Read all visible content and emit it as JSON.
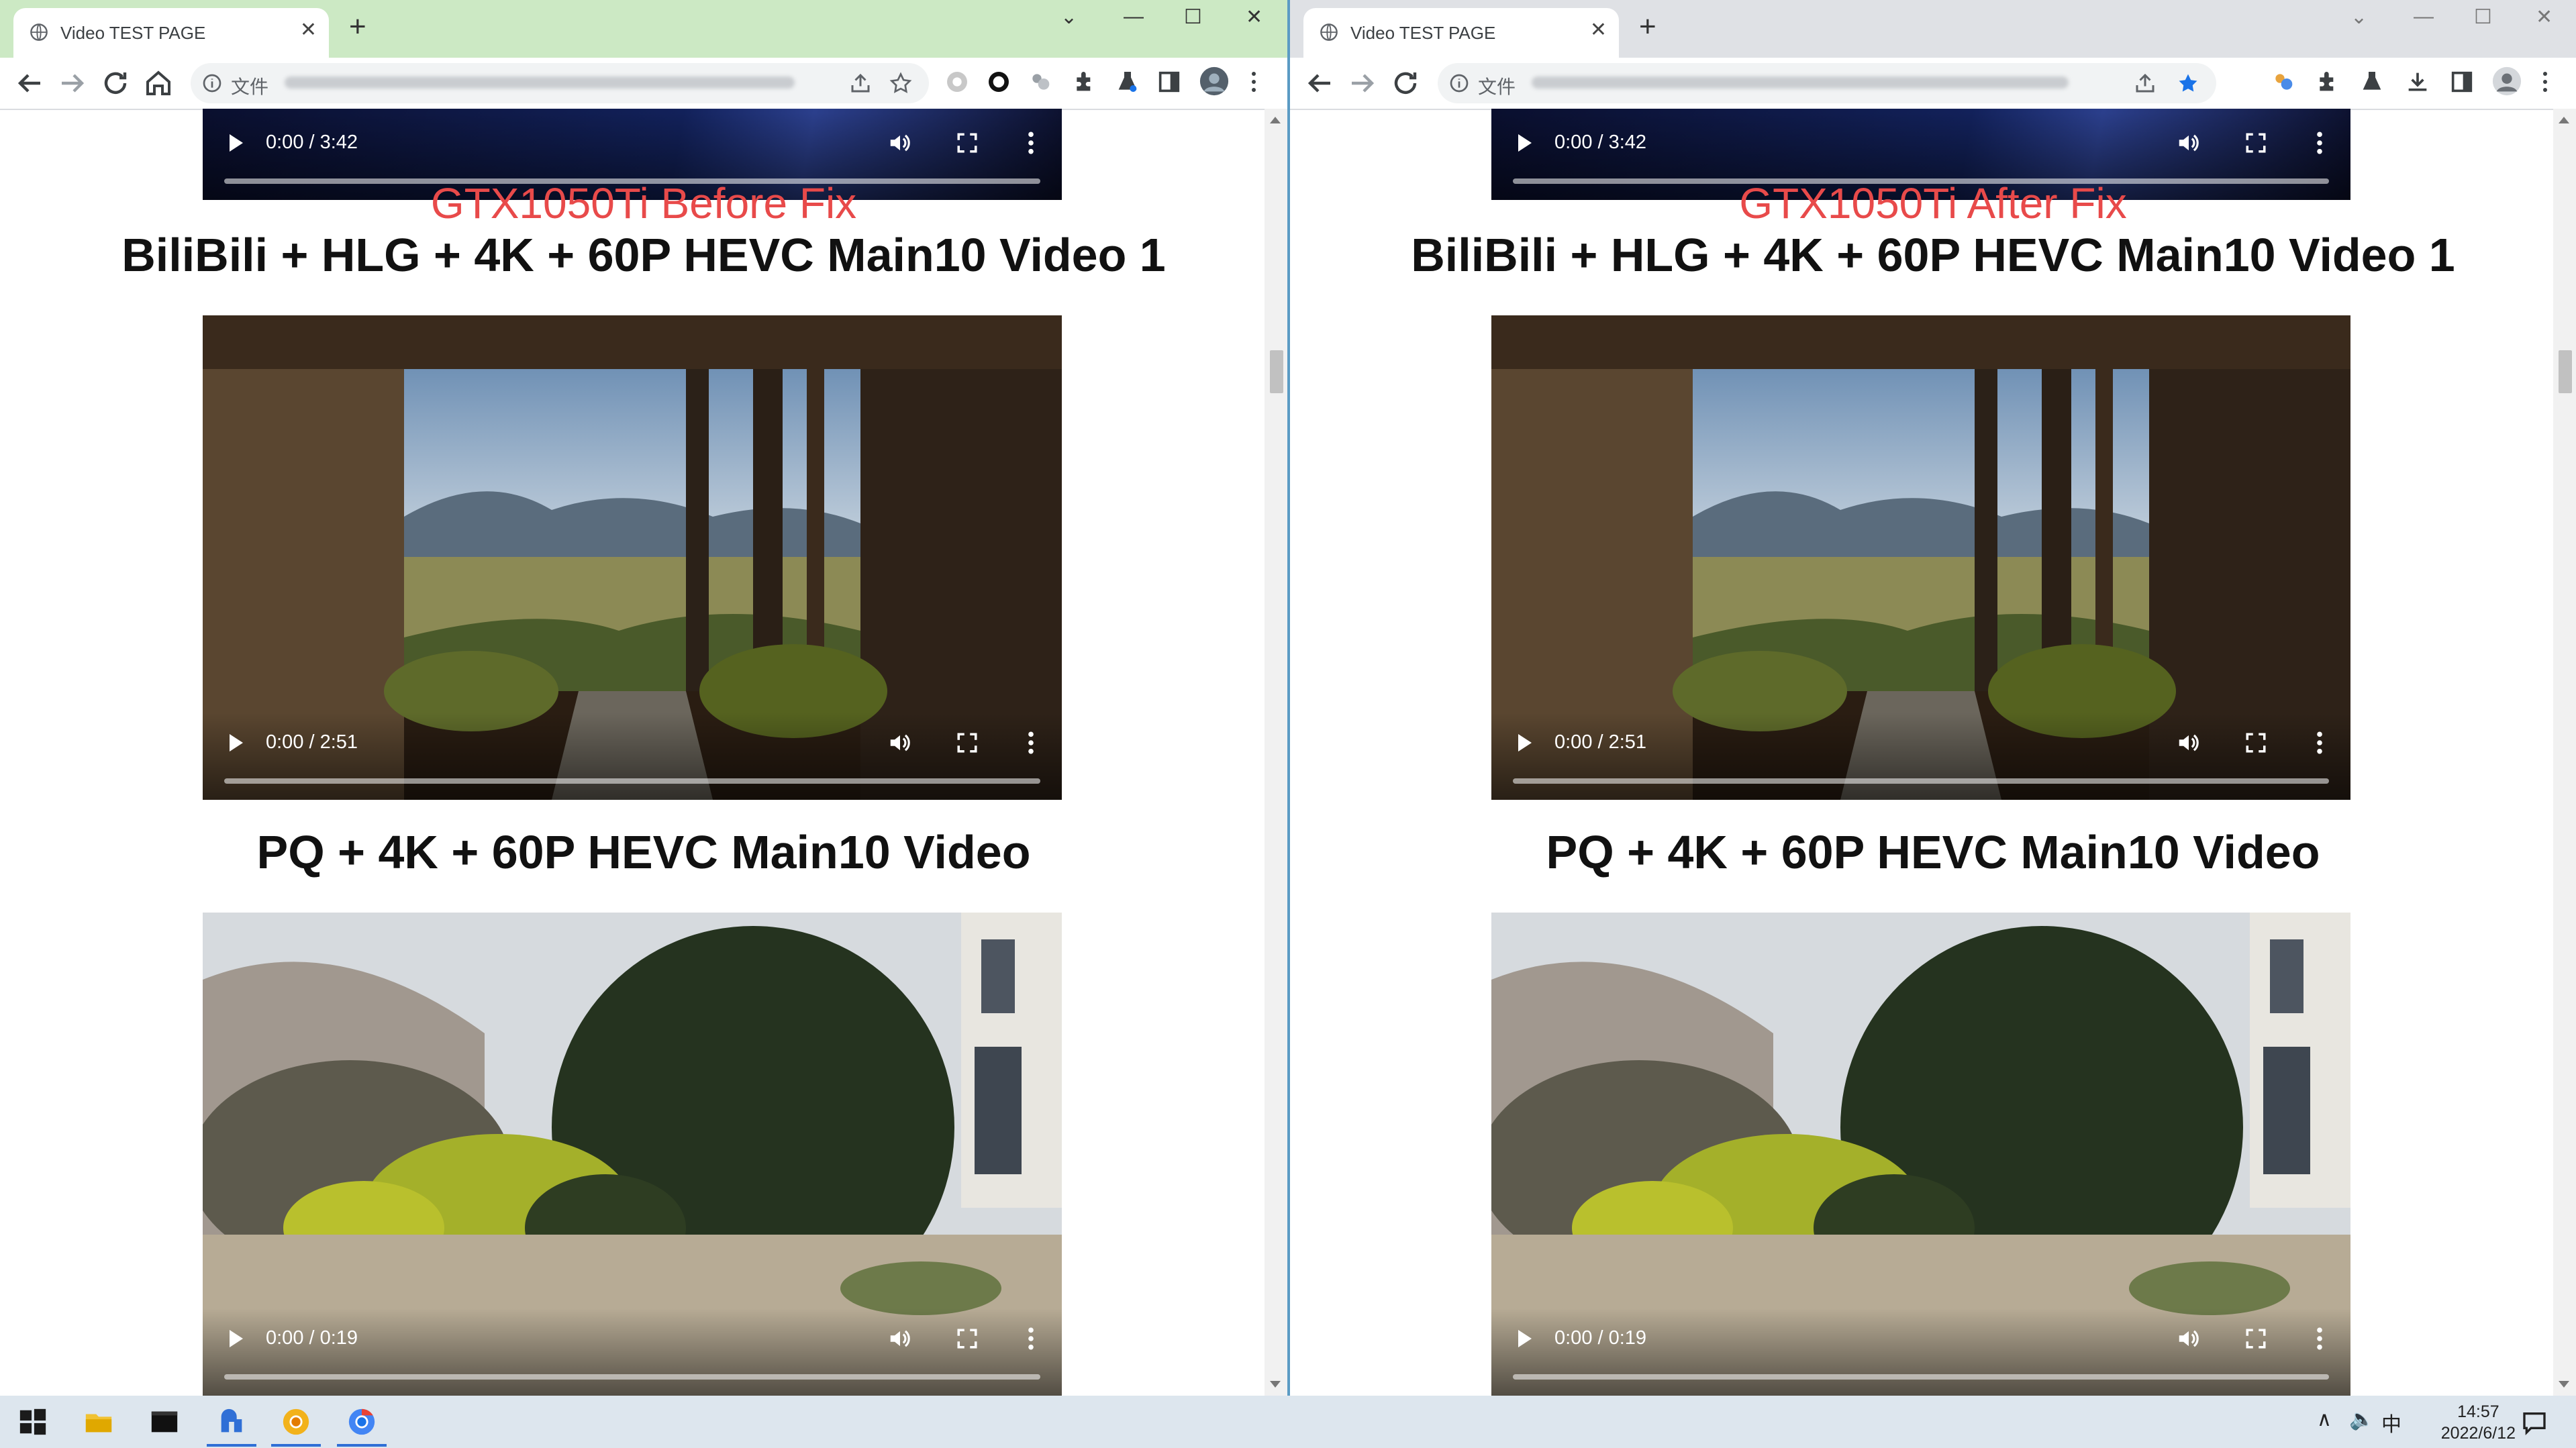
{
  "windows": [
    {
      "id": "left",
      "tab_title": "Video TEST PAGE",
      "address_label": "文件",
      "overlay_label": "GTX1050Ti Before Fix",
      "videos": [
        {
          "time": "0:00 / 3:42"
        },
        {
          "heading": "BiliBili + HLG + 4K + 60P HEVC Main10 Video 1",
          "time": "0:00 / 2:51"
        },
        {
          "heading": "PQ + 4K + 60P HEVC Main10 Video",
          "time": "0:00 / 0:19"
        }
      ]
    },
    {
      "id": "right",
      "tab_title": "Video TEST PAGE",
      "address_label": "文件",
      "overlay_label": "GTX1050Ti After Fix",
      "videos": [
        {
          "time": "0:00 / 3:42"
        },
        {
          "heading": "BiliBili + HLG + 4K + 60P HEVC Main10 Video 1",
          "time": "0:00 / 2:51"
        },
        {
          "heading": "PQ + 4K + 60P HEVC Main10 Video",
          "time": "0:00 / 0:19"
        }
      ]
    }
  ],
  "taskbar": {
    "ime": "中",
    "time": "14:57",
    "date": "2022/6/12"
  },
  "colors": {
    "active_tabstrip": "#cce9c4",
    "inactive_tabstrip": "#dfe1e5",
    "overlay_text": "#e84a4a",
    "bookmark_star_active": "#1a73e8"
  }
}
